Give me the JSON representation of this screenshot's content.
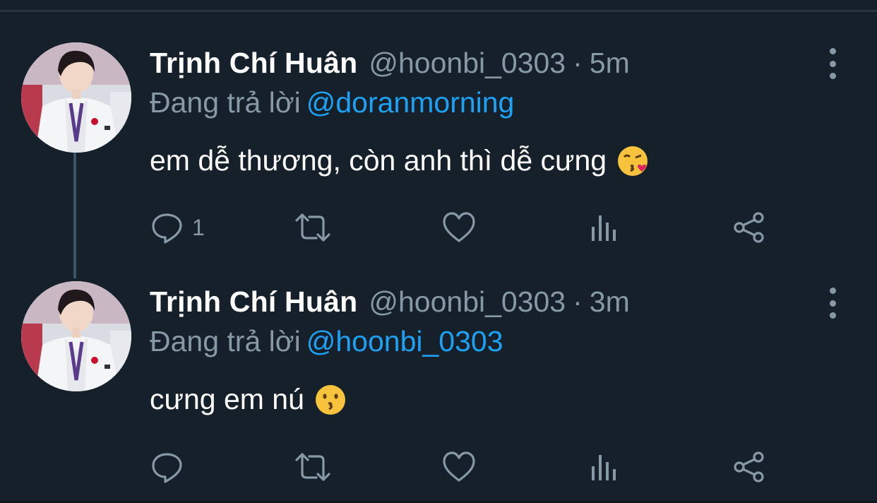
{
  "tweets": [
    {
      "name": "Trịnh Chí Huân",
      "handle": "@hoonbi_0303",
      "separator": "·",
      "time": "5m",
      "reply_prefix": "Đang trả lời",
      "reply_to": "@doranmorning",
      "text": "em dễ thương, còn anh thì dễ cưng",
      "emoji": "face-blowing-a-kiss",
      "reply_count": "1"
    },
    {
      "name": "Trịnh Chí Huân",
      "handle": "@hoonbi_0303",
      "separator": "·",
      "time": "3m",
      "reply_prefix": "Đang trả lời",
      "reply_to": "@hoonbi_0303",
      "text": "cưng em nú",
      "emoji": "kissing-face",
      "reply_count": ""
    }
  ],
  "icons": {
    "reply": "speech-bubble-icon",
    "retweet": "retweet-icon",
    "like": "heart-icon",
    "analytics": "bar-chart-icon",
    "share": "share-icon",
    "more": "vertical-ellipsis-icon"
  },
  "colors": {
    "background": "#15202b",
    "name": "#ffffff",
    "muted": "#8899a6",
    "link": "#1da1f2",
    "thread_line": "#3d5466"
  }
}
